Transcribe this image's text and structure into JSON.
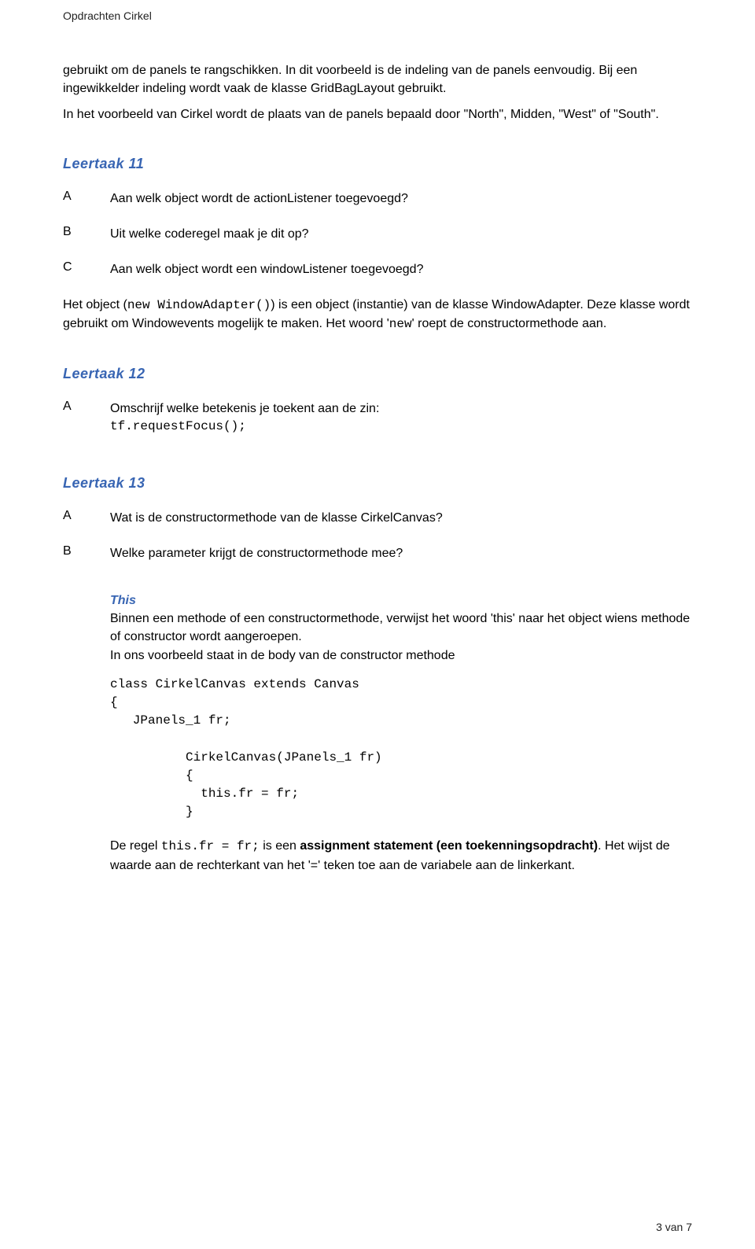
{
  "runningHeader": "Opdrachten Cirkel",
  "intro": {
    "p1": "gebruikt om de panels te rangschikken. In dit voorbeeld is de indeling van de panels eenvoudig. Bij een ingewikkelder indeling wordt vaak de klasse GridBagLayout gebruikt.",
    "p2": "In het voorbeeld van Cirkel wordt de plaats van de panels bepaald door \"North\", Midden, \"West\" of \"South\"."
  },
  "leertaak11": {
    "heading": "Leertaak 11",
    "A": {
      "letter": "A",
      "text": "Aan welk object wordt de actionListener toegevoegd?"
    },
    "B": {
      "letter": "B",
      "text": "Uit welke coderegel maak je dit op?"
    },
    "C": {
      "letter": "C",
      "text": "Aan welk object wordt een windowListener toegevoegd?"
    },
    "expl_pre": "Het object (",
    "expl_code": "new WindowAdapter()",
    "expl_post": ")  is een object (instantie) van de klasse WindowAdapter. Deze klasse wordt gebruikt om Windowevents mogelijk te maken. Het woord '",
    "expl_code2": "new",
    "expl_tail": "' roept de constructormethode aan."
  },
  "leertaak12": {
    "heading": "Leertaak 12",
    "A": {
      "letter": "A",
      "line1": "Omschrijf welke betekenis je toekent aan de zin:",
      "code": "tf.requestFocus();"
    }
  },
  "leertaak13": {
    "heading": "Leertaak 13",
    "A": {
      "letter": "A",
      "text": "Wat is de constructormethode van de klasse CirkelCanvas?"
    },
    "B": {
      "letter": "B",
      "text": "Welke parameter krijgt de constructormethode mee?"
    },
    "this": {
      "heading": "This",
      "p1": "Binnen een methode of een constructormethode, verwijst het woord 'this' naar het object wiens methode of constructor wordt aangeroepen.",
      "p2": "In ons voorbeeld staat in de body van de constructor methode",
      "code": "class CirkelCanvas extends Canvas\n{\n   JPanels_1 fr;\n\n          CirkelCanvas(JPanels_1 fr)\n          {\n            this.fr = fr;\n          }",
      "closing_pre": "De regel ",
      "closing_code": "this.fr = fr;",
      "closing_mid": "  is een ",
      "closing_bold": "assignment statement (een toekenningsopdracht)",
      "closing_post": ". Het wijst de waarde aan de rechterkant van het '=' teken toe aan de variabele aan de linkerkant."
    }
  },
  "footer": "3 van 7"
}
